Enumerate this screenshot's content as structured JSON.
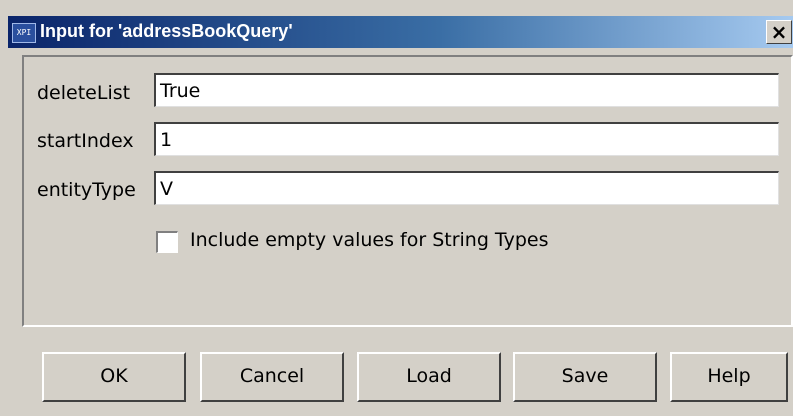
{
  "window": {
    "icon_text": "XPI",
    "title": "Input for 'addressBookQuery'",
    "close_symbol": "×"
  },
  "fields": [
    {
      "label": "deleteList",
      "value": "True"
    },
    {
      "label": "startIndex",
      "value": "1"
    },
    {
      "label": "entityType",
      "value": "V"
    }
  ],
  "checkbox": {
    "label": "Include empty values for String Types",
    "checked": false
  },
  "buttons": {
    "ok": "OK",
    "cancel": "Cancel",
    "load": "Load",
    "save": "Save",
    "help": "Help"
  }
}
